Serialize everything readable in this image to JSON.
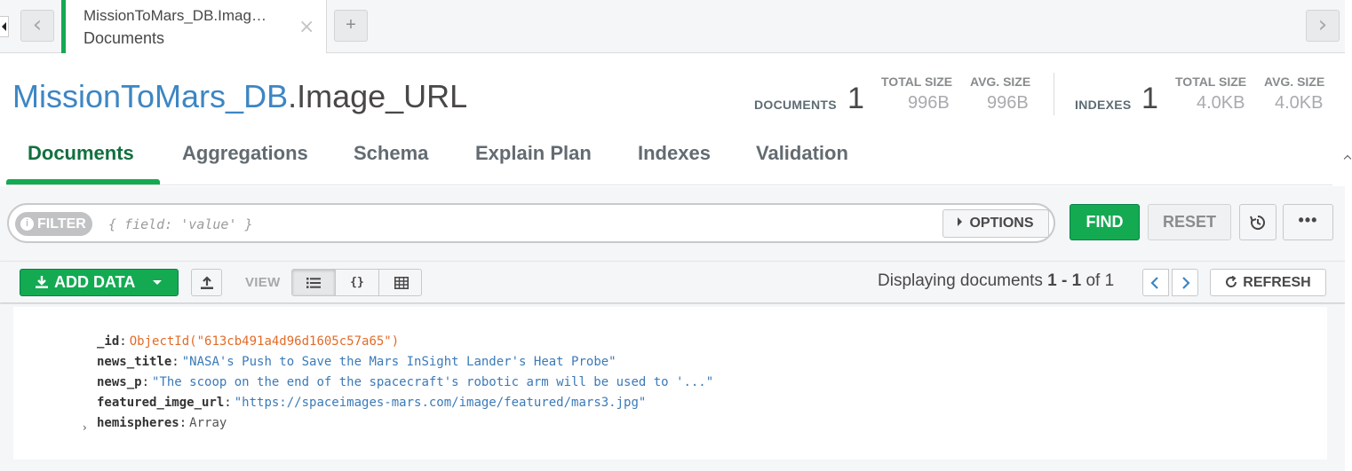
{
  "tab": {
    "title": "MissionToMars_DB.Imag…",
    "subtitle": "Documents",
    "close_glyph": "×",
    "add_glyph": "+"
  },
  "nav": {
    "prev_glyph": "‹",
    "next_glyph": "›"
  },
  "collection": {
    "db_name": "MissionToMars_DB",
    "coll_name": ".Image_URL"
  },
  "stats": {
    "documents_label": "DOCUMENTS",
    "documents_count": "1",
    "doc_total_size_label": "TOTAL SIZE",
    "doc_total_size": "996B",
    "doc_avg_size_label": "AVG. SIZE",
    "doc_avg_size": "996B",
    "indexes_label": "INDEXES",
    "indexes_count": "1",
    "idx_total_size_label": "TOTAL SIZE",
    "idx_total_size": "4.0KB",
    "idx_avg_size_label": "AVG. SIZE",
    "idx_avg_size": "4.0KB"
  },
  "tabs": [
    {
      "label": "Documents",
      "active": true
    },
    {
      "label": "Aggregations"
    },
    {
      "label": "Schema"
    },
    {
      "label": "Explain Plan"
    },
    {
      "label": "Indexes"
    },
    {
      "label": "Validation"
    }
  ],
  "filter": {
    "pill_label": "FILTER",
    "pill_icon": "i",
    "placeholder": "{ field: 'value' }",
    "value": "",
    "options_label": "OPTIONS",
    "find_label": "FIND",
    "reset_label": "RESET",
    "more_label": "•••"
  },
  "toolbar": {
    "add_data_label": "ADD DATA",
    "view_label": "VIEW",
    "display_prefix": "Displaying documents ",
    "display_range": "1 - 1",
    "display_suffix": " of 1",
    "refresh_label": "REFRESH"
  },
  "document": {
    "fields": [
      {
        "key": "_id",
        "value": "ObjectId(\"613cb491a4d96d1605c57a65\")",
        "kind": "oid"
      },
      {
        "key": "news_title",
        "value": "\"NASA's Push to Save the Mars InSight Lander's Heat Probe\"",
        "kind": "str"
      },
      {
        "key": "news_p",
        "value": "\"The scoop on the end of the spacecraft's robotic arm will be used to '...\"",
        "kind": "str"
      },
      {
        "key": "featured_imge_url",
        "value": "\"https://spaceimages-mars.com/image/featured/mars3.jpg\"",
        "kind": "str"
      },
      {
        "key": "hemispheres",
        "value": "Array",
        "kind": "arr",
        "expandable": true
      }
    ],
    "expander_glyph": "›"
  },
  "colors": {
    "accent_green": "#13aa52",
    "db_blue": "#3d86c4",
    "oid_orange": "#e36b28",
    "string_blue": "#3b7ab8"
  },
  "icons": {
    "download": "download-icon",
    "upload": "upload-icon",
    "list_view": "list-view-icon",
    "json_view": "json-view-icon",
    "table_view": "table-view-icon",
    "history": "history-icon",
    "refresh": "refresh-icon"
  }
}
